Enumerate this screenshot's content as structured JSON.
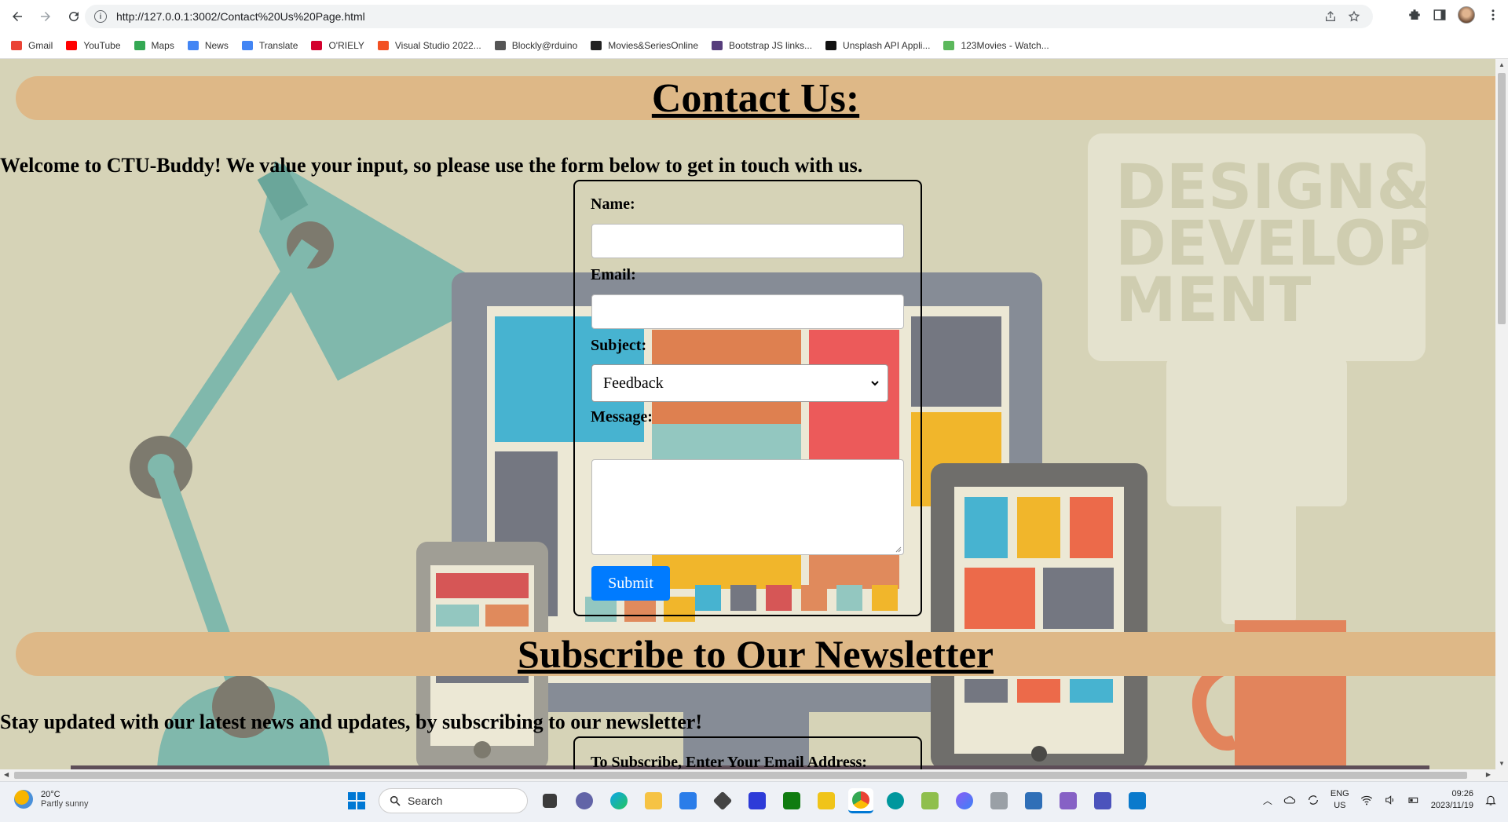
{
  "browser": {
    "url": "http://127.0.0.1:3002/Contact%20Us%20Page.html",
    "bookmarks": [
      {
        "label": "Gmail",
        "icon": "gmail-icon",
        "color": "#ea4335"
      },
      {
        "label": "YouTube",
        "icon": "youtube-icon",
        "color": "#ff0000"
      },
      {
        "label": "Maps",
        "icon": "maps-icon",
        "color": "#34a853"
      },
      {
        "label": "News",
        "icon": "news-icon",
        "color": "#4285f4"
      },
      {
        "label": "Translate",
        "icon": "translate-icon",
        "color": "#4285f4"
      },
      {
        "label": "O'RIELY",
        "icon": "oreilly-icon",
        "color": "#d3002d"
      },
      {
        "label": "Visual Studio 2022...",
        "icon": "visual-studio-icon",
        "color": "#f25022"
      },
      {
        "label": "Blockly@rduino",
        "icon": "blockly-icon",
        "color": "#555555"
      },
      {
        "label": "Movies&SeriesOnline",
        "icon": "movies-icon",
        "color": "#222222"
      },
      {
        "label": "Bootstrap JS links...",
        "icon": "bootstrap-icon",
        "color": "#563d7c"
      },
      {
        "label": "Unsplash API Appli...",
        "icon": "unsplash-icon",
        "color": "#111111"
      },
      {
        "label": "123Movies - Watch...",
        "icon": "123movies-icon",
        "color": "#5cb85c"
      }
    ]
  },
  "page": {
    "contact_title": "Contact Us:",
    "welcome_text": "Welcome to CTU-Buddy! We value your input, so please use the form below to get in touch with us.",
    "form": {
      "name_label": "Name:",
      "name_value": "",
      "email_label": "Email:",
      "email_value": "",
      "subject_label": "Subject:",
      "subject_selected": "Feedback",
      "message_label": "Message:",
      "message_value": "",
      "submit_label": "Submit"
    },
    "newsletter_title": "Subscribe to Our Newsletter",
    "newsletter_text": "Stay updated with our latest news and updates, by subscribing to our newsletter!",
    "subscribe_label": "To Subscribe, Enter Your Email Address:",
    "background_poster_text": [
      "DESIGN&",
      "DEVELOP",
      "MENT"
    ],
    "colors": {
      "banner": "#deb887",
      "submit_button": "#007bff"
    }
  },
  "taskbar": {
    "weather_temp": "20°C",
    "weather_desc": "Partly sunny",
    "search_label": "Search",
    "lang_top": "ENG",
    "lang_bottom": "US",
    "time": "09:26",
    "date": "2023/11/19"
  }
}
